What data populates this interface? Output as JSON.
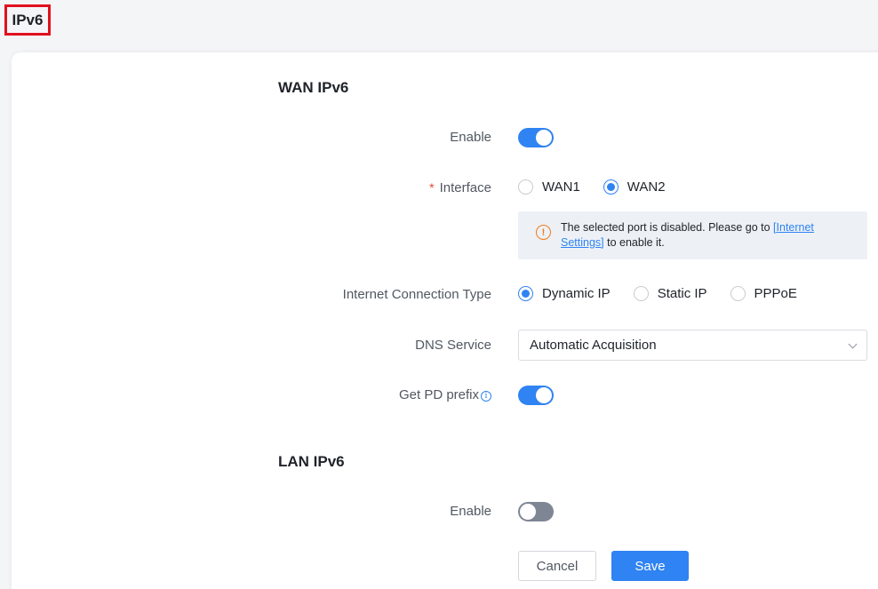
{
  "page": {
    "title": "IPv6"
  },
  "wan": {
    "title": "WAN IPv6",
    "enable_label": "Enable",
    "enable_on": true,
    "interface_required": "*",
    "interface_label": "Interface",
    "interface_options": [
      "WAN1",
      "WAN2"
    ],
    "interface_selected": "WAN2",
    "notice_text_1": "The selected port is disabled. Please go to ",
    "notice_link": "[Internet Settings]",
    "notice_text_2": " to enable it.",
    "conn_type_label": "Internet Connection Type",
    "conn_type_options": [
      "Dynamic IP",
      "Static IP",
      "PPPoE"
    ],
    "conn_type_selected": "Dynamic IP",
    "dns_label": "DNS Service",
    "dns_value": "Automatic Acquisition",
    "pd_label": "Get PD prefix",
    "pd_on": true
  },
  "lan": {
    "title": "LAN IPv6",
    "enable_label": "Enable",
    "enable_on": false
  },
  "buttons": {
    "cancel": "Cancel",
    "save": "Save"
  },
  "colors": {
    "accent": "#2f83f2",
    "warning": "#f07a1a",
    "required": "#e8432e",
    "title_outline": "#e0101e"
  }
}
